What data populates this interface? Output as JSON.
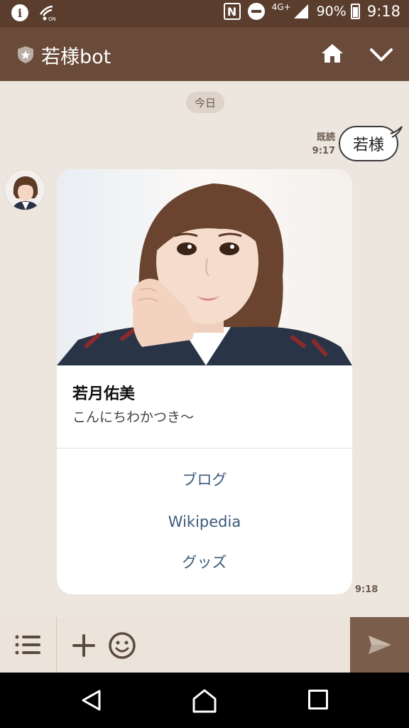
{
  "status_bar": {
    "network": "4G+",
    "battery": "90%",
    "time": "9:18",
    "icons": [
      "info-icon",
      "signal-on-icon",
      "nfc-icon",
      "do-not-disturb-icon",
      "cell-signal-icon",
      "battery-icon"
    ]
  },
  "header": {
    "title": "若様bot",
    "icons": [
      "shield-icon",
      "home-icon",
      "chevron-down-icon"
    ]
  },
  "chat": {
    "date_label": "今日",
    "user_message": {
      "text": "若様",
      "read_label": "既読",
      "time": "9:17"
    },
    "bot_card": {
      "name": "若月佑美",
      "description": "こんにちわかつき〜",
      "actions": [
        "ブログ",
        "Wikipedia",
        "グッズ"
      ],
      "time": "9:18"
    }
  },
  "input_bar": {
    "icons": [
      "menu-icon",
      "plus-icon",
      "emoji-icon",
      "send-icon"
    ]
  },
  "nav_bar": {
    "icons": [
      "back-icon",
      "home-icon",
      "recent-apps-icon"
    ]
  },
  "colors": {
    "header": "#6a4a38",
    "status_bar": "#5a3d2d",
    "chat_background": "#ede6df",
    "link": "#3b5a7a"
  }
}
